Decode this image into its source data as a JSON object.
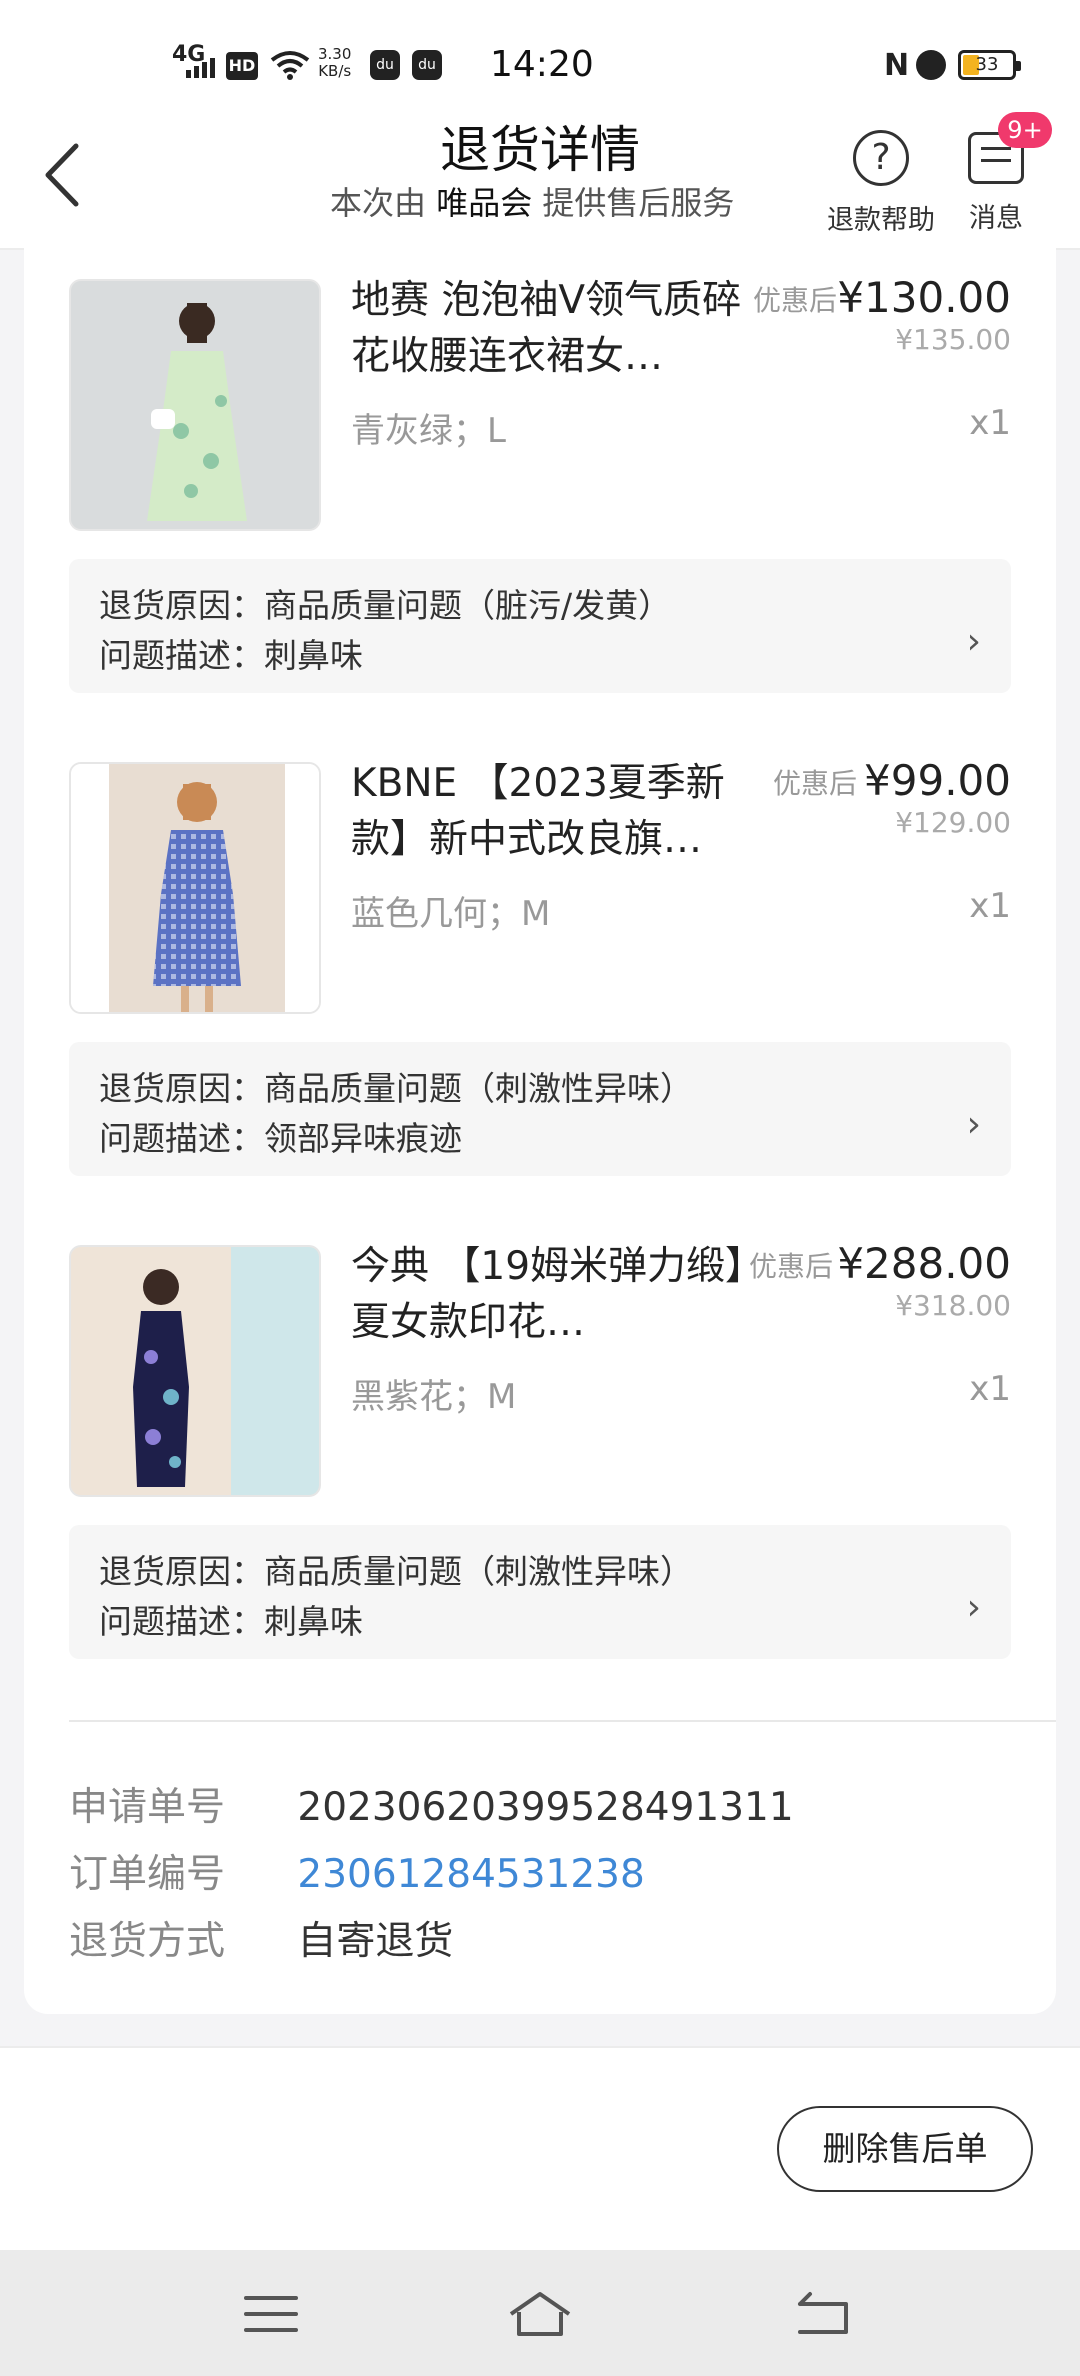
{
  "status_bar": {
    "network": "4G",
    "hd": "HD",
    "speed_value": "3.30",
    "speed_unit": "KB/s",
    "time": "14:20",
    "battery": "33",
    "battery_level": 0.33
  },
  "header": {
    "title": "退货详情",
    "subtitle_prefix": "本次由",
    "subtitle_brand": "唯品会",
    "subtitle_suffix": "提供售后服务",
    "help_label": "退款帮助",
    "help_icon": "?",
    "message_label": "消息",
    "message_badge": "9+"
  },
  "items": [
    {
      "name": "地赛 泡泡袖V领气质碎花收腰连衣裙女…",
      "discount_label": "优惠后",
      "price": "¥130.00",
      "original_price": "¥135.00",
      "spec": "青灰绿；L",
      "qty": "x1",
      "reason_label": "退货原因：",
      "reason": "商品质量问题（脏污/发黄）",
      "desc_label": "问题描述：",
      "desc": "刺鼻味"
    },
    {
      "name": "KBNE 【2023夏季新款】新中式改良旗…",
      "discount_label": "优惠后",
      "price": "¥99.00",
      "original_price": "¥129.00",
      "spec": "蓝色几何；M",
      "qty": "x1",
      "reason_label": "退货原因：",
      "reason": "商品质量问题（刺激性异味）",
      "desc_label": "问题描述：",
      "desc": "领部异味痕迹"
    },
    {
      "name": "今典 【19姆米弹力缎】夏女款印花…",
      "discount_label": "优惠后",
      "price": "¥288.00",
      "original_price": "¥318.00",
      "spec": "黑紫花；M",
      "qty": "x1",
      "reason_label": "退货原因：",
      "reason": "商品质量问题（刺激性异味）",
      "desc_label": "问题描述：",
      "desc": "刺鼻味"
    }
  ],
  "info": {
    "apply_no_label": "申请单号",
    "apply_no": "20230620399528491311",
    "order_no_label": "订单编号",
    "order_no": "23061284531238",
    "return_method_label": "退货方式",
    "return_method": "自寄退货"
  },
  "bottom": {
    "delete_label": "删除售后单"
  },
  "colors": {
    "badge": "#f0396c",
    "link": "#3f88d6",
    "battery": "#f3b320"
  },
  "icons": [
    "back-icon",
    "help-icon",
    "message-icon",
    "chevron-right-icon",
    "menu-icon",
    "home-icon",
    "return-icon"
  ]
}
